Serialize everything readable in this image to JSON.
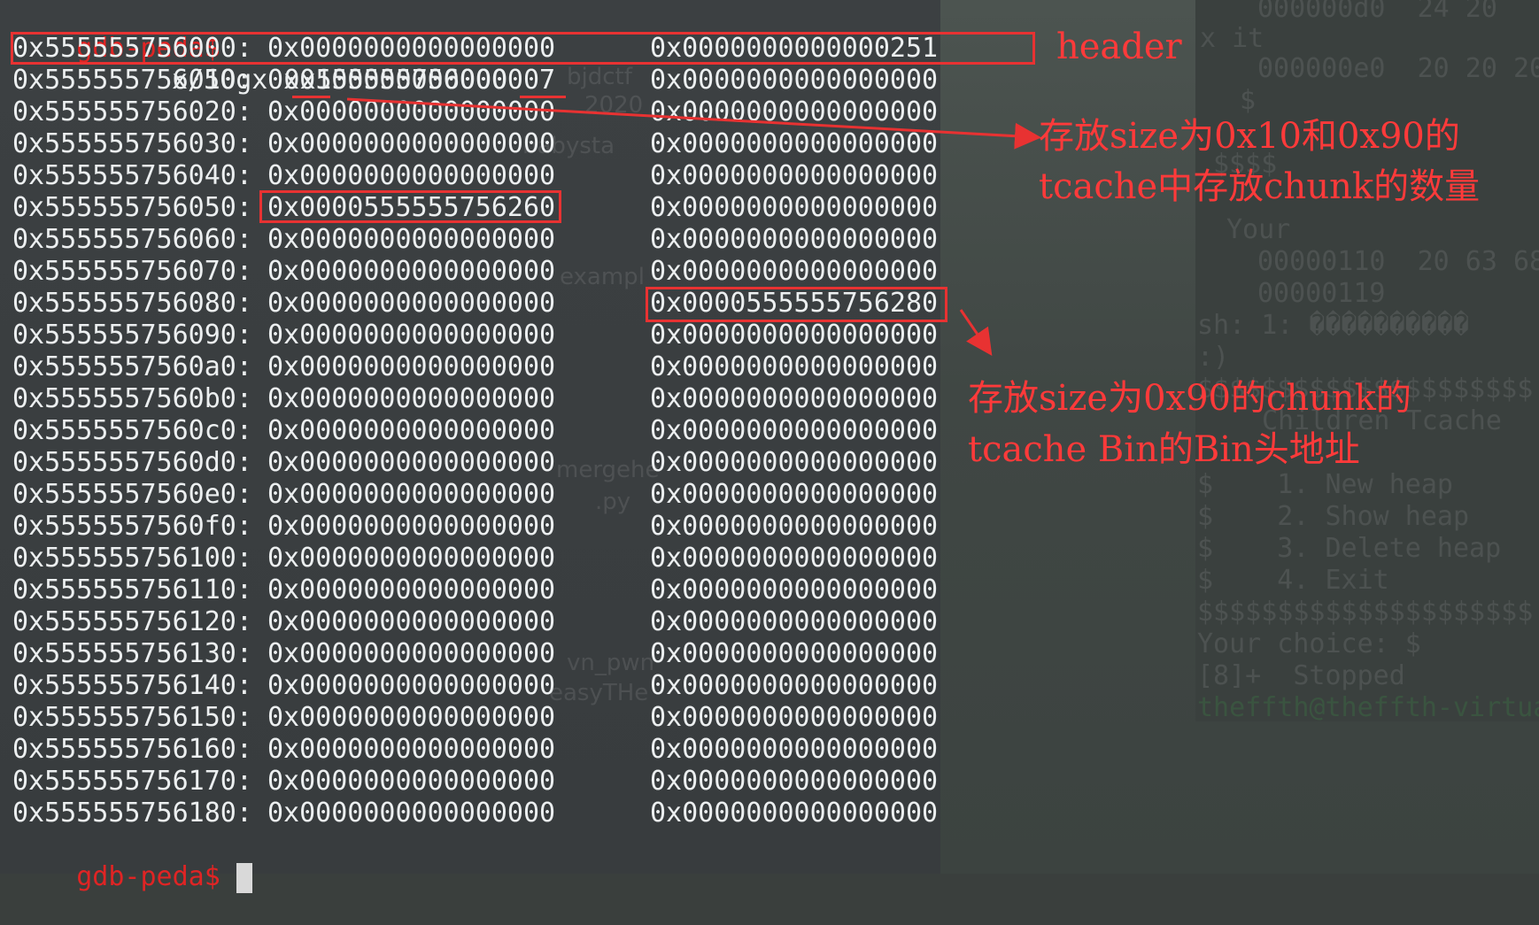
{
  "terminal": {
    "command_prompt": "gdb-peda$",
    "command": "x/50gx 0x555555756000",
    "final_prompt": "gdb-peda$",
    "rows": [
      {
        "addr": "0x555555756000:",
        "v1": "0x0000000000000000",
        "v2": "0x0000000000000251"
      },
      {
        "addr": "0x555555756010:",
        "v1": "0x0100000000000007",
        "v2": "0x0000000000000000"
      },
      {
        "addr": "0x555555756020:",
        "v1": "0x0000000000000000",
        "v2": "0x0000000000000000"
      },
      {
        "addr": "0x555555756030:",
        "v1": "0x0000000000000000",
        "v2": "0x0000000000000000"
      },
      {
        "addr": "0x555555756040:",
        "v1": "0x0000000000000000",
        "v2": "0x0000000000000000"
      },
      {
        "addr": "0x555555756050:",
        "v1": "0x0000555555756260",
        "v2": "0x0000000000000000"
      },
      {
        "addr": "0x555555756060:",
        "v1": "0x0000000000000000",
        "v2": "0x0000000000000000"
      },
      {
        "addr": "0x555555756070:",
        "v1": "0x0000000000000000",
        "v2": "0x0000000000000000"
      },
      {
        "addr": "0x555555756080:",
        "v1": "0x0000000000000000",
        "v2": "0x0000555555756280"
      },
      {
        "addr": "0x555555756090:",
        "v1": "0x0000000000000000",
        "v2": "0x0000000000000000"
      },
      {
        "addr": "0x5555557560a0:",
        "v1": "0x0000000000000000",
        "v2": "0x0000000000000000"
      },
      {
        "addr": "0x5555557560b0:",
        "v1": "0x0000000000000000",
        "v2": "0x0000000000000000"
      },
      {
        "addr": "0x5555557560c0:",
        "v1": "0x0000000000000000",
        "v2": "0x0000000000000000"
      },
      {
        "addr": "0x5555557560d0:",
        "v1": "0x0000000000000000",
        "v2": "0x0000000000000000"
      },
      {
        "addr": "0x5555557560e0:",
        "v1": "0x0000000000000000",
        "v2": "0x0000000000000000"
      },
      {
        "addr": "0x5555557560f0:",
        "v1": "0x0000000000000000",
        "v2": "0x0000000000000000"
      },
      {
        "addr": "0x555555756100:",
        "v1": "0x0000000000000000",
        "v2": "0x0000000000000000"
      },
      {
        "addr": "0x555555756110:",
        "v1": "0x0000000000000000",
        "v2": "0x0000000000000000"
      },
      {
        "addr": "0x555555756120:",
        "v1": "0x0000000000000000",
        "v2": "0x0000000000000000"
      },
      {
        "addr": "0x555555756130:",
        "v1": "0x0000000000000000",
        "v2": "0x0000000000000000"
      },
      {
        "addr": "0x555555756140:",
        "v1": "0x0000000000000000",
        "v2": "0x0000000000000000"
      },
      {
        "addr": "0x555555756150:",
        "v1": "0x0000000000000000",
        "v2": "0x0000000000000000"
      },
      {
        "addr": "0x555555756160:",
        "v1": "0x0000000000000000",
        "v2": "0x0000000000000000"
      },
      {
        "addr": "0x555555756170:",
        "v1": "0x0000000000000000",
        "v2": "0x0000000000000000"
      },
      {
        "addr": "0x555555756180:",
        "v1": "0x0000000000000000",
        "v2": "0x0000000000000000"
      }
    ]
  },
  "annotations": {
    "header_label": "header",
    "counts_note_line1": "存放size为0x10和0x90的",
    "counts_note_line2": "tcache中存放chunk的数量",
    "bin_note_line1": "存放size为0x90的chunk的",
    "bin_note_line2": "tcache Bin的Bin头地址",
    "color": "#ff3a3a"
  },
  "background": {
    "desktop_labels": [
      "bjdctf",
      "2020",
      "babysta",
      "exampl",
      "mergehe",
      ".py",
      "vn_pwn",
      "easyTHe"
    ],
    "right_terminal_lines": [
      "000000d0  24 20",
      "x it",
      "000000e0  20 20 20",
      "$",
      "$$$$",
      "Your",
      "00000110  20 63 68",
      "00000119",
      "sh: 1: ����������",
      ":)",
      "$$$$$$$$$$$$$$$$$$$$$",
      "Children Tcache",
      "$    1. New heap",
      "$    2. Show heap",
      "$    3. Delete heap",
      "$    4. Exit",
      "$$$$$$$$$$$$$$$$$$$$$",
      "Your choice: $",
      "[8]+  Stopped",
      "theffth@theffth-virtua"
    ]
  }
}
